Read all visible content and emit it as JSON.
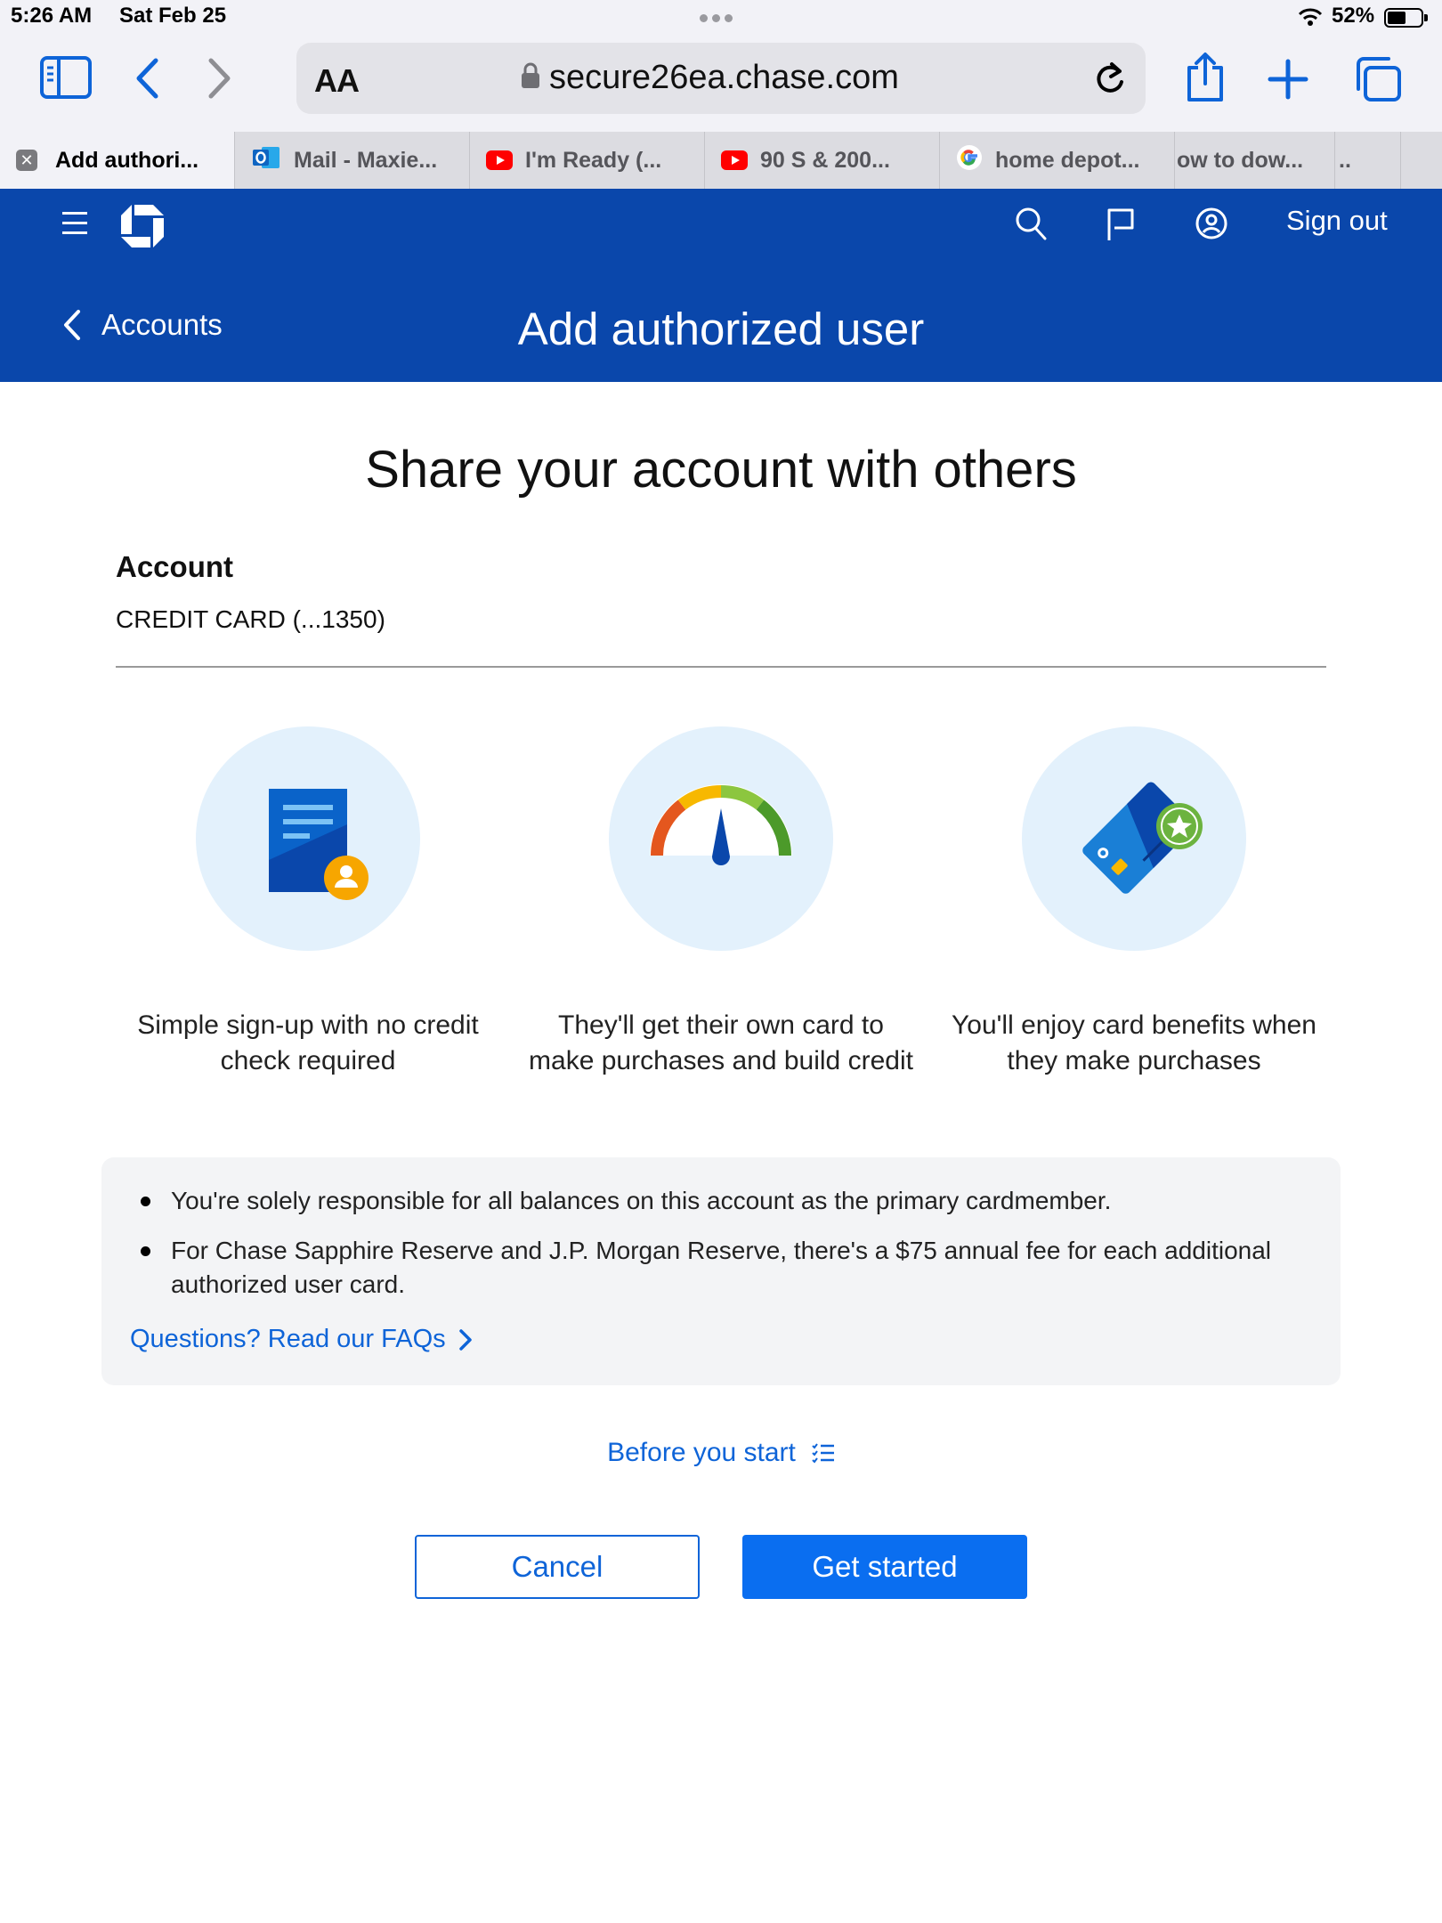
{
  "status_bar": {
    "time": "5:26 AM",
    "date": "Sat Feb 25",
    "battery": "52%",
    "battery_level": 0.52
  },
  "browser": {
    "text_size_label": "AA",
    "url": "secure26ea.chase.com",
    "tabs": [
      {
        "title": "Add authori...",
        "icon": "close-icon",
        "active": true
      },
      {
        "title": "Mail - Maxie...",
        "icon": "outlook-icon"
      },
      {
        "title": "I'm Ready (...",
        "icon": "youtube-icon"
      },
      {
        "title": "90 S & 200...",
        "icon": "youtube-icon"
      },
      {
        "title": "home depot...",
        "icon": "google-icon"
      },
      {
        "title": "ow to dow...",
        "icon": "none"
      },
      {
        "title": "..",
        "icon": "none"
      }
    ]
  },
  "header": {
    "sign_out": "Sign out",
    "back_label": "Accounts",
    "title": "Add authorized user"
  },
  "main": {
    "heading": "Share your account with others",
    "account_label": "Account",
    "account_value": "CREDIT CARD (...1350)",
    "features": [
      {
        "icon": "document-user-icon",
        "text": "Simple sign-up with no credit check required"
      },
      {
        "icon": "credit-gauge-icon",
        "text": "They'll get their own card to make purchases and build credit"
      },
      {
        "icon": "card-star-icon",
        "text": "You'll enjoy card benefits when they make purchases"
      }
    ],
    "notes": [
      "You're solely responsible for all balances on this account as the primary cardmember.",
      "For Chase Sapphire Reserve and J.P. Morgan Reserve, there's a $75 annual fee for each additional authorized user card."
    ],
    "faq_link": "Questions? Read our FAQs",
    "before_start": "Before you start",
    "cancel_button": "Cancel",
    "start_button": "Get started"
  },
  "colors": {
    "header_blue": "#0a47ab",
    "link_blue": "#0e64d8",
    "button_blue": "#0a6ef0",
    "circle_bg": "#e3f1fc"
  }
}
